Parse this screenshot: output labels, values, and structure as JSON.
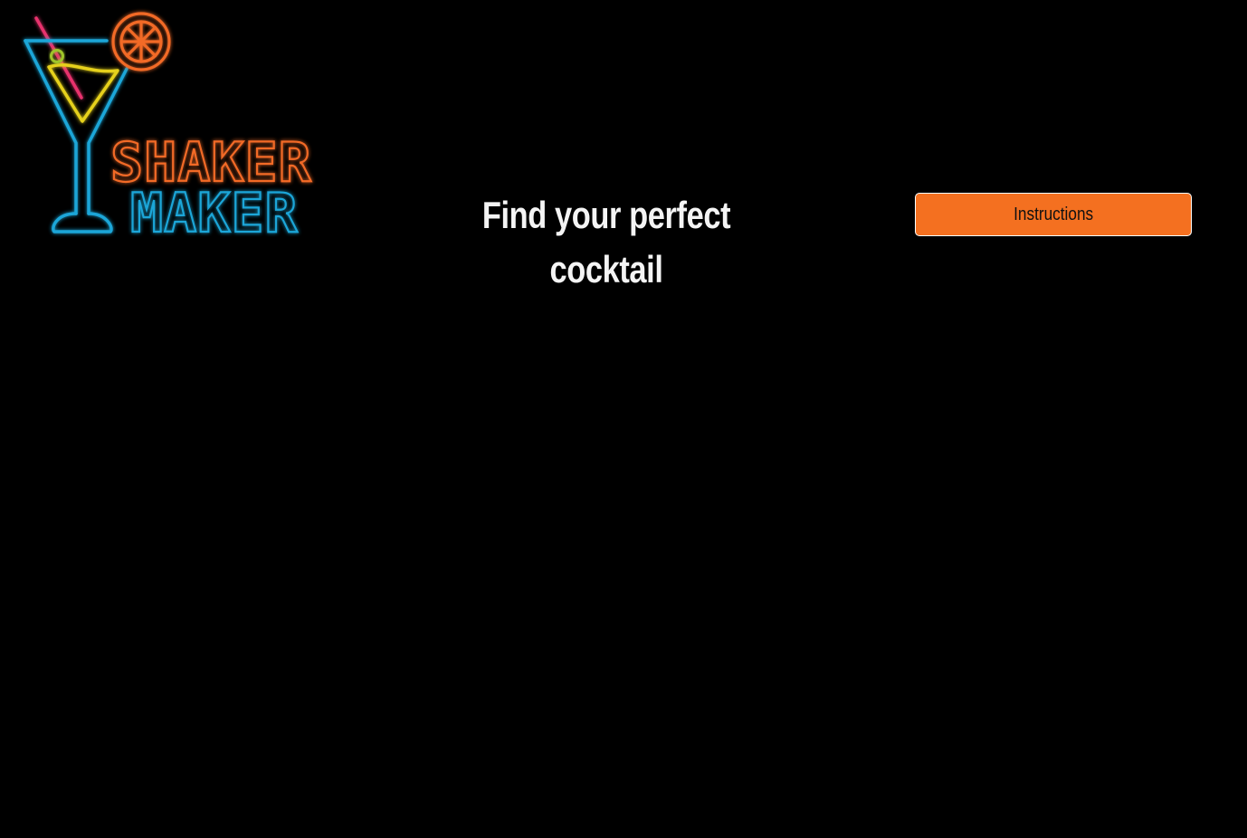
{
  "logo": {
    "line1": "SHAKER",
    "line2": "MAKER",
    "icon": "cocktail-glass-icon",
    "colors": {
      "glass": "#1aa6d8",
      "orange": "#f26a28",
      "straw": "#e8336d",
      "liquid": "#e6d11a",
      "olive": "#9fc52a"
    }
  },
  "header": {
    "title": "Find your perfect cocktail",
    "instructions_label": "Instructions"
  },
  "colors": {
    "background": "#000000",
    "accent": "#f47020",
    "title_text": "#f4f4f4"
  }
}
